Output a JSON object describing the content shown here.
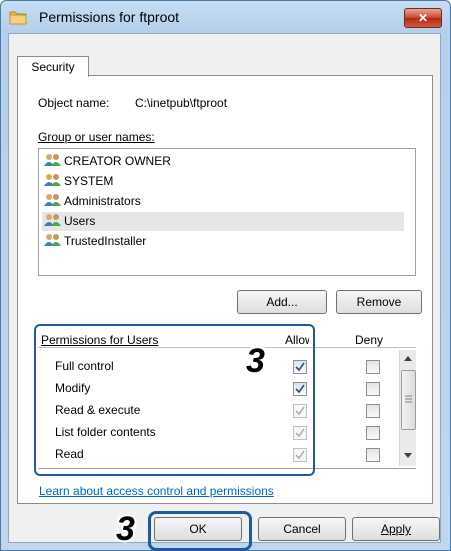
{
  "window": {
    "title": "Permissions for ftproot",
    "close_label": "✕"
  },
  "tabs": [
    {
      "label": "Security"
    }
  ],
  "object": {
    "label": "Object name:",
    "value": "C:\\inetpub\\ftproot"
  },
  "group_list": {
    "label": "Group or user names:",
    "items": [
      {
        "label": "CREATOR OWNER",
        "icon": "users-icon"
      },
      {
        "label": "SYSTEM",
        "icon": "users-icon"
      },
      {
        "label": "Administrators",
        "icon": "users-icon"
      },
      {
        "label": "Users",
        "icon": "users-icon",
        "selected": true
      },
      {
        "label": "TrustedInstaller",
        "icon": "users-icon"
      }
    ]
  },
  "buttons": {
    "add": "Add...",
    "remove": "Remove",
    "ok": "OK",
    "cancel": "Cancel",
    "apply": "Apply"
  },
  "permissions": {
    "header": "Permissions for Users",
    "allow_header": "Allow",
    "deny_header": "Deny",
    "rows": [
      {
        "label": "Full control",
        "allow": true,
        "allow_enabled": true,
        "deny": false
      },
      {
        "label": "Modify",
        "allow": true,
        "allow_enabled": true,
        "deny": false
      },
      {
        "label": "Read & execute",
        "allow": true,
        "allow_enabled": false,
        "deny": false
      },
      {
        "label": "List folder contents",
        "allow": true,
        "allow_enabled": false,
        "deny": false
      },
      {
        "label": "Read",
        "allow": true,
        "allow_enabled": false,
        "deny": false
      }
    ]
  },
  "link": "Learn about access control and permissions",
  "callouts": {
    "step_permissions": "3",
    "step_ok": "3"
  },
  "colors": {
    "highlight": "#1f5aa0",
    "link": "#0066cc",
    "close_button": "#c9442f"
  }
}
